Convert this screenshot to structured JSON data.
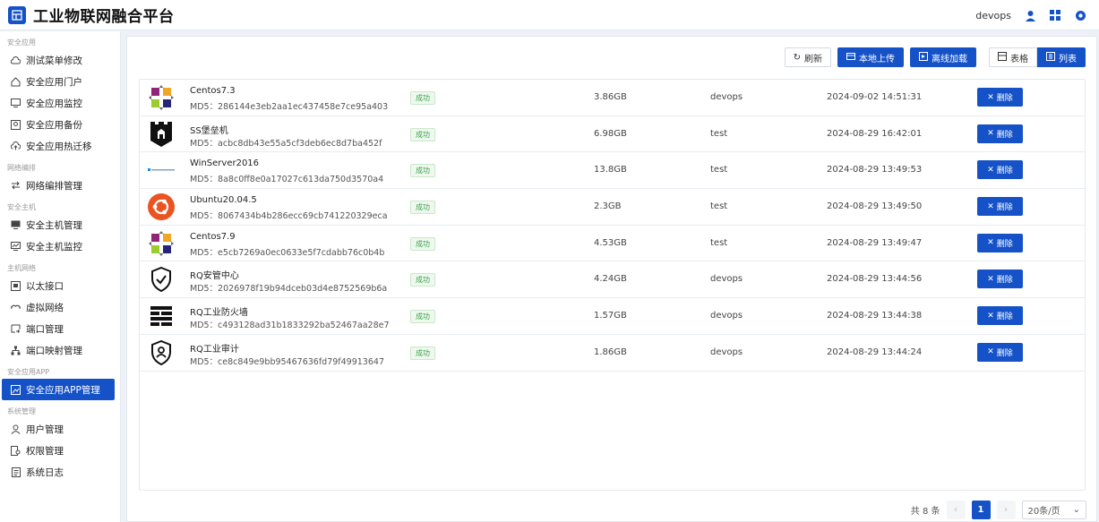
{
  "app": {
    "title": "工业物联网融合平台",
    "user": "devops"
  },
  "sidebar": {
    "groups": [
      {
        "title": "安全应用",
        "items": [
          {
            "label": "测试菜单修改",
            "icon": "cloud-icon"
          },
          {
            "label": "安全应用门户",
            "icon": "home-icon"
          },
          {
            "label": "安全应用监控",
            "icon": "monitor-icon"
          },
          {
            "label": "安全应用备份",
            "icon": "backup-icon"
          },
          {
            "label": "安全应用热迁移",
            "icon": "cloud-upload-icon"
          }
        ]
      },
      {
        "title": "网络编排",
        "items": [
          {
            "label": "网络编排管理",
            "icon": "swap-icon"
          }
        ]
      },
      {
        "title": "安全主机",
        "items": [
          {
            "label": "安全主机管理",
            "icon": "desktop-icon"
          },
          {
            "label": "安全主机监控",
            "icon": "desktop-chart-icon"
          }
        ]
      },
      {
        "title": "主机网络",
        "items": [
          {
            "label": "以太接口",
            "icon": "ethernet-icon"
          },
          {
            "label": "虚拟网络",
            "icon": "link-icon"
          },
          {
            "label": "端口管理",
            "icon": "port-icon"
          },
          {
            "label": "端口映射管理",
            "icon": "sitemap-icon"
          }
        ]
      },
      {
        "title": "安全应用APP",
        "items": [
          {
            "label": "安全应用APP管理",
            "icon": "app-image-icon",
            "active": true
          }
        ]
      },
      {
        "title": "系统管理",
        "items": [
          {
            "label": "用户管理",
            "icon": "user-icon"
          },
          {
            "label": "权限管理",
            "icon": "permission-icon"
          },
          {
            "label": "系统日志",
            "icon": "log-icon"
          }
        ]
      }
    ]
  },
  "toolbar": {
    "refresh": "刷新",
    "upload": "本地上传",
    "offline_load": "离线加载",
    "view_table": "表格",
    "view_list": "列表"
  },
  "rows": [
    {
      "name": "Centos7.3",
      "md5": "MD5：286144e3eb2aa1ec437458e7ce95a403",
      "status": "成功",
      "size": "3.86GB",
      "owner": "devops",
      "time": "2024-09-02 14:51:31",
      "icon": "centos-icon"
    },
    {
      "name": "SS堡垒机",
      "md5": "MD5：acbc8db43e55a5cf3deb6ec8d7ba452f",
      "status": "成功",
      "size": "6.98GB",
      "owner": "test",
      "time": "2024-08-29 16:42:01",
      "icon": "bastion-icon"
    },
    {
      "name": "WinServer2016",
      "md5": "MD5：8a8c0ff8e0a17027c613da750d3570a4",
      "status": "成功",
      "size": "13.8GB",
      "owner": "test",
      "time": "2024-08-29 13:49:53",
      "icon": "windows-icon"
    },
    {
      "name": "Ubuntu20.04.5",
      "md5": "MD5：8067434b4b286ecc69cb741220329eca",
      "status": "成功",
      "size": "2.3GB",
      "owner": "test",
      "time": "2024-08-29 13:49:50",
      "icon": "ubuntu-icon"
    },
    {
      "name": "Centos7.9",
      "md5": "MD5：e5cb7269a0ec0633e5f7cdabb76c0b4b",
      "status": "成功",
      "size": "4.53GB",
      "owner": "test",
      "time": "2024-08-29 13:49:47",
      "icon": "centos-icon"
    },
    {
      "name": "RQ安管中心",
      "md5": "MD5：2026978f19b94dceb03d4e8752569b6a",
      "status": "成功",
      "size": "4.24GB",
      "owner": "devops",
      "time": "2024-08-29 13:44:56",
      "icon": "shield-check-icon"
    },
    {
      "name": "RQ工业防火墙",
      "md5": "MD5：c493128ad31b1833292ba52467aa28e7",
      "status": "成功",
      "size": "1.57GB",
      "owner": "devops",
      "time": "2024-08-29 13:44:38",
      "icon": "firewall-icon"
    },
    {
      "name": "RQ工业审计",
      "md5": "MD5：ce8c849e9bb95467636fd79f49913647",
      "status": "成功",
      "size": "1.86GB",
      "owner": "devops",
      "time": "2024-08-29 13:44:24",
      "icon": "audit-icon"
    }
  ],
  "delete_label": "删除",
  "pagination": {
    "total": "共 8 条",
    "current": "1",
    "page_size": "20条/页"
  },
  "colors": {
    "primary": "#1552c7",
    "success": "#3aa34a"
  }
}
